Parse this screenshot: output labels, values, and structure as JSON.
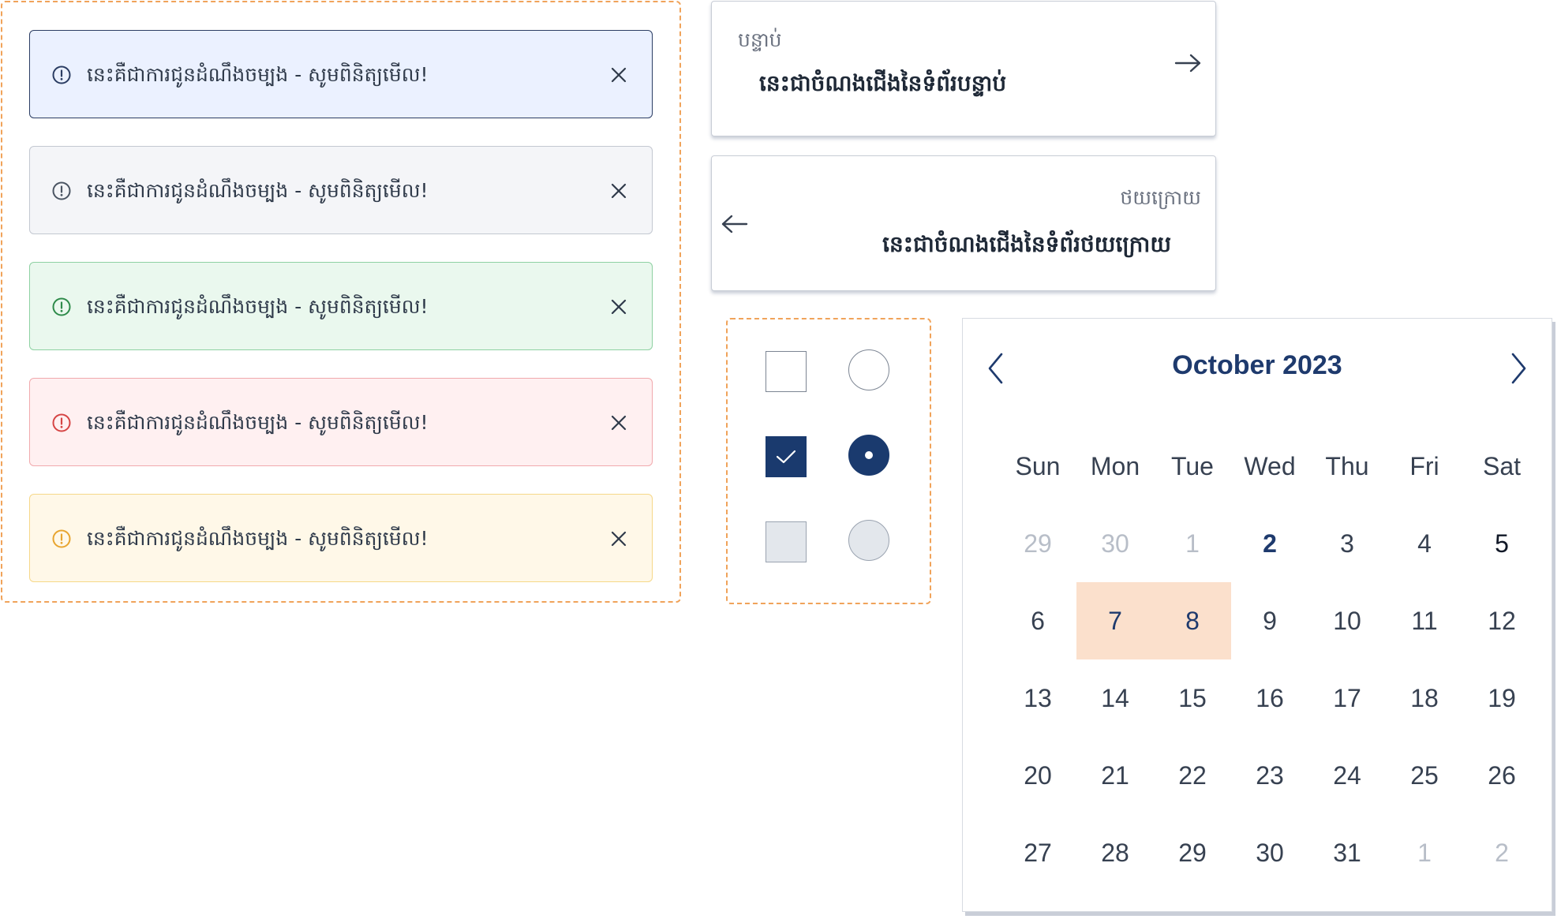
{
  "alerts": [
    {
      "variant": "info",
      "icon": "alert-circle-icon",
      "color": "#2b3d63",
      "text": "នេះគឺជាការជូនដំណឹងចម្បង - សូមពិនិត្យមើល!"
    },
    {
      "variant": "neutral",
      "icon": "alert-circle-icon",
      "color": "#4b5563",
      "text": "នេះគឺជាការជូនដំណឹងចម្បង - សូមពិនិត្យមើល!"
    },
    {
      "variant": "success",
      "icon": "alert-circle-icon",
      "color": "#2e8b4a",
      "text": "នេះគឺជាការជូនដំណឹងចម្បង - សូមពិនិត្យមើល!"
    },
    {
      "variant": "error",
      "icon": "alert-circle-icon",
      "color": "#d64545",
      "text": "នេះគឺជាការជូនដំណឹងចម្បង - សូមពិនិត្យមើល!"
    },
    {
      "variant": "warning",
      "icon": "alert-circle-icon",
      "color": "#e8a530",
      "text": "នេះគឺជាការជូនដំណឹងចម្បង - សូមពិនិត្យមើល!"
    }
  ],
  "pagination": {
    "next": {
      "kicker": "បន្ទាប់",
      "title": "នេះជាចំណងជើងនៃទំព័របន្ទាប់",
      "icon": "arrow-right-icon"
    },
    "prev": {
      "kicker": "ថយក្រោយ",
      "title": "នេះជាចំណងជើងនៃទំព័រថយក្រោយ",
      "icon": "arrow-left-icon"
    }
  },
  "controls": {
    "checkboxes": [
      "unchecked",
      "checked",
      "disabled"
    ],
    "radios": [
      "unchecked",
      "checked",
      "disabled"
    ]
  },
  "calendar": {
    "title": "October 2023",
    "weekdays": [
      "Sun",
      "Mon",
      "Tue",
      "Wed",
      "Thu",
      "Fri",
      "Sat"
    ],
    "weeks": [
      [
        {
          "d": "29",
          "s": "out"
        },
        {
          "d": "30",
          "s": "out"
        },
        {
          "d": "1",
          "s": "out"
        },
        {
          "d": "2",
          "s": "today"
        },
        {
          "d": "3"
        },
        {
          "d": "4"
        },
        {
          "d": "5",
          "s": "strong"
        }
      ],
      [
        {
          "d": "6"
        },
        {
          "d": "7",
          "s": "selected"
        },
        {
          "d": "8",
          "s": "selected"
        },
        {
          "d": "9"
        },
        {
          "d": "10"
        },
        {
          "d": "11"
        },
        {
          "d": "12"
        }
      ],
      [
        {
          "d": "13"
        },
        {
          "d": "14"
        },
        {
          "d": "15"
        },
        {
          "d": "16"
        },
        {
          "d": "17"
        },
        {
          "d": "18"
        },
        {
          "d": "19"
        }
      ],
      [
        {
          "d": "20"
        },
        {
          "d": "21"
        },
        {
          "d": "22"
        },
        {
          "d": "23"
        },
        {
          "d": "24"
        },
        {
          "d": "25"
        },
        {
          "d": "26"
        }
      ],
      [
        {
          "d": "27"
        },
        {
          "d": "28"
        },
        {
          "d": "29"
        },
        {
          "d": "30"
        },
        {
          "d": "31"
        },
        {
          "d": "1",
          "s": "out"
        },
        {
          "d": "2",
          "s": "out"
        }
      ]
    ],
    "colors": {
      "accent": "#1e3a6d",
      "selected_bg": "#fbe0cc"
    }
  }
}
